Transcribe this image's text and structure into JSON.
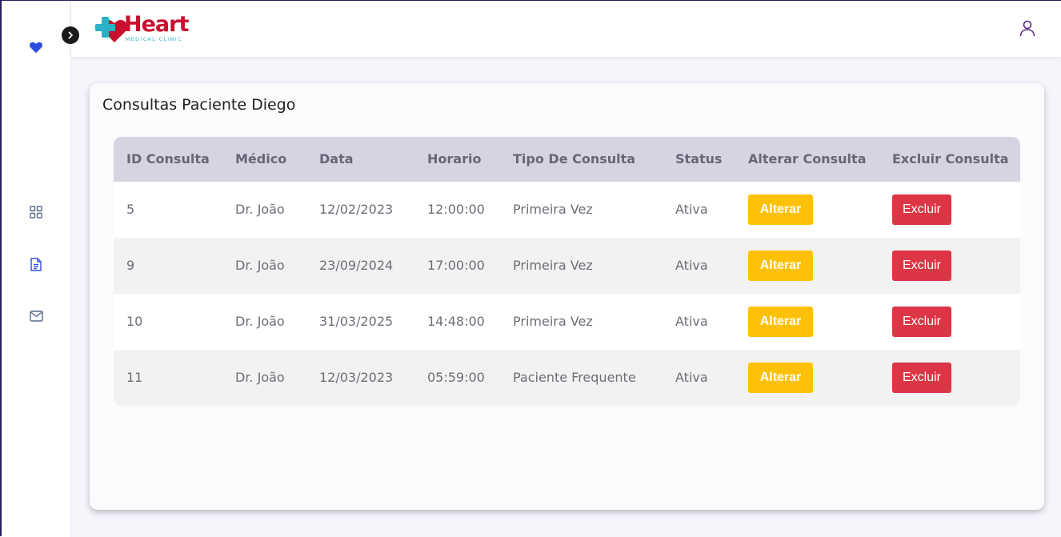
{
  "app": {
    "logo_text": "Heart",
    "logo_subtitle": "MEDICAL CLINIC"
  },
  "sidebar": {
    "icons": [
      "heart-icon",
      "grid-icon",
      "document-icon",
      "mail-icon"
    ],
    "accent": "#2b4de0"
  },
  "page": {
    "title": "Consultas Paciente Diego"
  },
  "table": {
    "headers": [
      "ID Consulta",
      "Médico",
      "Data",
      "Horario",
      "Tipo De Consulta",
      "Status",
      "Alterar Consulta",
      "Excluir Consulta"
    ],
    "rows": [
      {
        "id": "5",
        "medico": "Dr. João",
        "data": "12/02/2023",
        "horario": "12:00:00",
        "tipo": "Primeira Vez",
        "status": "Ativa",
        "alterar": "Alterar",
        "excluir": "Excluir"
      },
      {
        "id": "9",
        "medico": "Dr. João",
        "data": "23/09/2024",
        "horario": "17:00:00",
        "tipo": "Primeira Vez",
        "status": "Ativa",
        "alterar": "Alterar",
        "excluir": "Excluir"
      },
      {
        "id": "10",
        "medico": "Dr. João",
        "data": "31/03/2025",
        "horario": "14:48:00",
        "tipo": "Primeira Vez",
        "status": "Ativa",
        "alterar": "Alterar",
        "excluir": "Excluir"
      },
      {
        "id": "11",
        "medico": "Dr. João",
        "data": "12/03/2023",
        "horario": "05:59:00",
        "tipo": "Paciente Frequente",
        "status": "Ativa",
        "alterar": "Alterar",
        "excluir": "Excluir"
      }
    ]
  },
  "colors": {
    "alterar_button": "#ffc107",
    "excluir_button": "#dc3545",
    "brand_red": "#c8102e",
    "brand_teal": "#2bb0c6"
  }
}
